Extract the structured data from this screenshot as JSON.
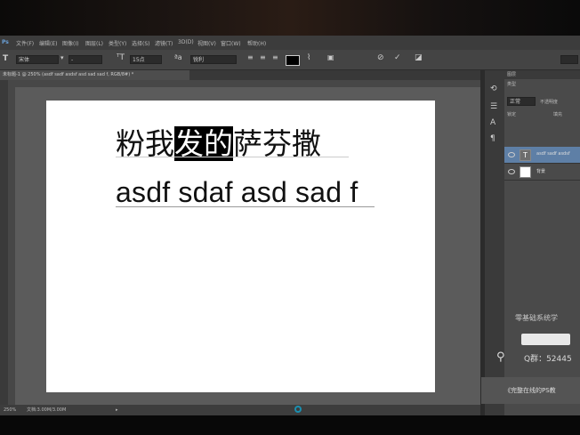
{
  "menu": {
    "items": [
      "文件(F)",
      "编辑(E)",
      "图像(I)",
      "图层(L)",
      "类型(Y)",
      "选择(S)",
      "滤镜(T)",
      "3D(D)",
      "视图(V)",
      "窗口(W)",
      "帮助(H)"
    ]
  },
  "options": {
    "tool_glyph": "T",
    "font_family": "宋体",
    "font_style": "-",
    "font_size": "15点",
    "leading": "",
    "antialias": "锐利",
    "color": "#000000"
  },
  "document": {
    "tab_title": "未标题-1 @ 250% (asdf sadf asdsf asd sad sad f, RGB/8#) *",
    "line1_before": "粉我",
    "line1_selected": "发的",
    "line1_after": "萨芬撒",
    "line2": "asdf sdaf asd sad f"
  },
  "status": {
    "zoom": "250%",
    "doc_info": "文档:3.00M/3.00M"
  },
  "layers_panel": {
    "tab_label": "图层",
    "kind_label": "类型",
    "blend_mode": "正常",
    "opacity_label": "不透明度",
    "lock_label": "锁定",
    "fill_label": "填充",
    "layers": [
      {
        "name": "asdf sadf asdsf",
        "type": "text",
        "selected": true
      },
      {
        "name": "背景",
        "type": "background",
        "selected": false
      }
    ]
  },
  "watermark": {
    "title": "零基础系统学",
    "qq": "Q群：52445",
    "promo": "《完整在线的PS教"
  }
}
